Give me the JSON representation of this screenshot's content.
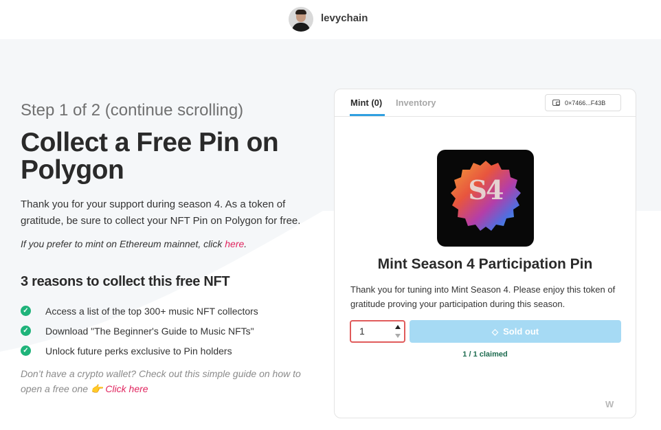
{
  "header": {
    "username": "levychain",
    "avatar_icon": "user-avatar"
  },
  "hero": {
    "step": "Step 1 of 2 (continue scrolling)",
    "headline": "Collect a Free Pin on Polygon",
    "intro": "Thank you for your support during season 4. As a token of gratitude, be sure to collect your NFT Pin on Polygon for free.",
    "eth_note_prefix": "If you prefer to mint on Ethereum mainnet, click ",
    "eth_note_link": "here",
    "eth_note_suffix": "."
  },
  "reasons": {
    "title": "3 reasons to collect this free NFT",
    "items": [
      "Access a list of the top 300+ music NFT collectors",
      "Download \"The Beginner's Guide to Music NFTs\"",
      "Unlock future perks exclusive to Pin holders"
    ],
    "check_icon": "check-circle-icon",
    "check_color": "#1fb37a"
  },
  "wallet_note": {
    "text": "Don’t have a crypto wallet? Check out this simple guide on how to open a free one ",
    "emoji": "👉",
    "link": "Click here"
  },
  "mint_card": {
    "tabs": [
      {
        "label": "Mint (0)",
        "active": true
      },
      {
        "label": "Inventory",
        "active": false
      }
    ],
    "wallet_address": "0×7466...F43B",
    "wallet_icon": "wallet-icon",
    "nft_image_text": "S4",
    "nft_title": "Mint Season 4 Participation Pin",
    "nft_description": "Thank you for tuning into Mint Season 4. Please enjoy this token of gratitude proving your participation during this season.",
    "quantity": "1",
    "button_label": "Sold out",
    "button_icon": "diamond-icon",
    "claimed": "1 / 1 claimed",
    "footer_logo": "mint-logo-icon",
    "footer_logo_text": "W"
  },
  "colors": {
    "accent": "#2f9fe0",
    "link": "#e0245e",
    "sold_out_button": "#a6daf4",
    "claimed_text": "#1d6b4f",
    "quantity_border": "#e05a5a"
  }
}
